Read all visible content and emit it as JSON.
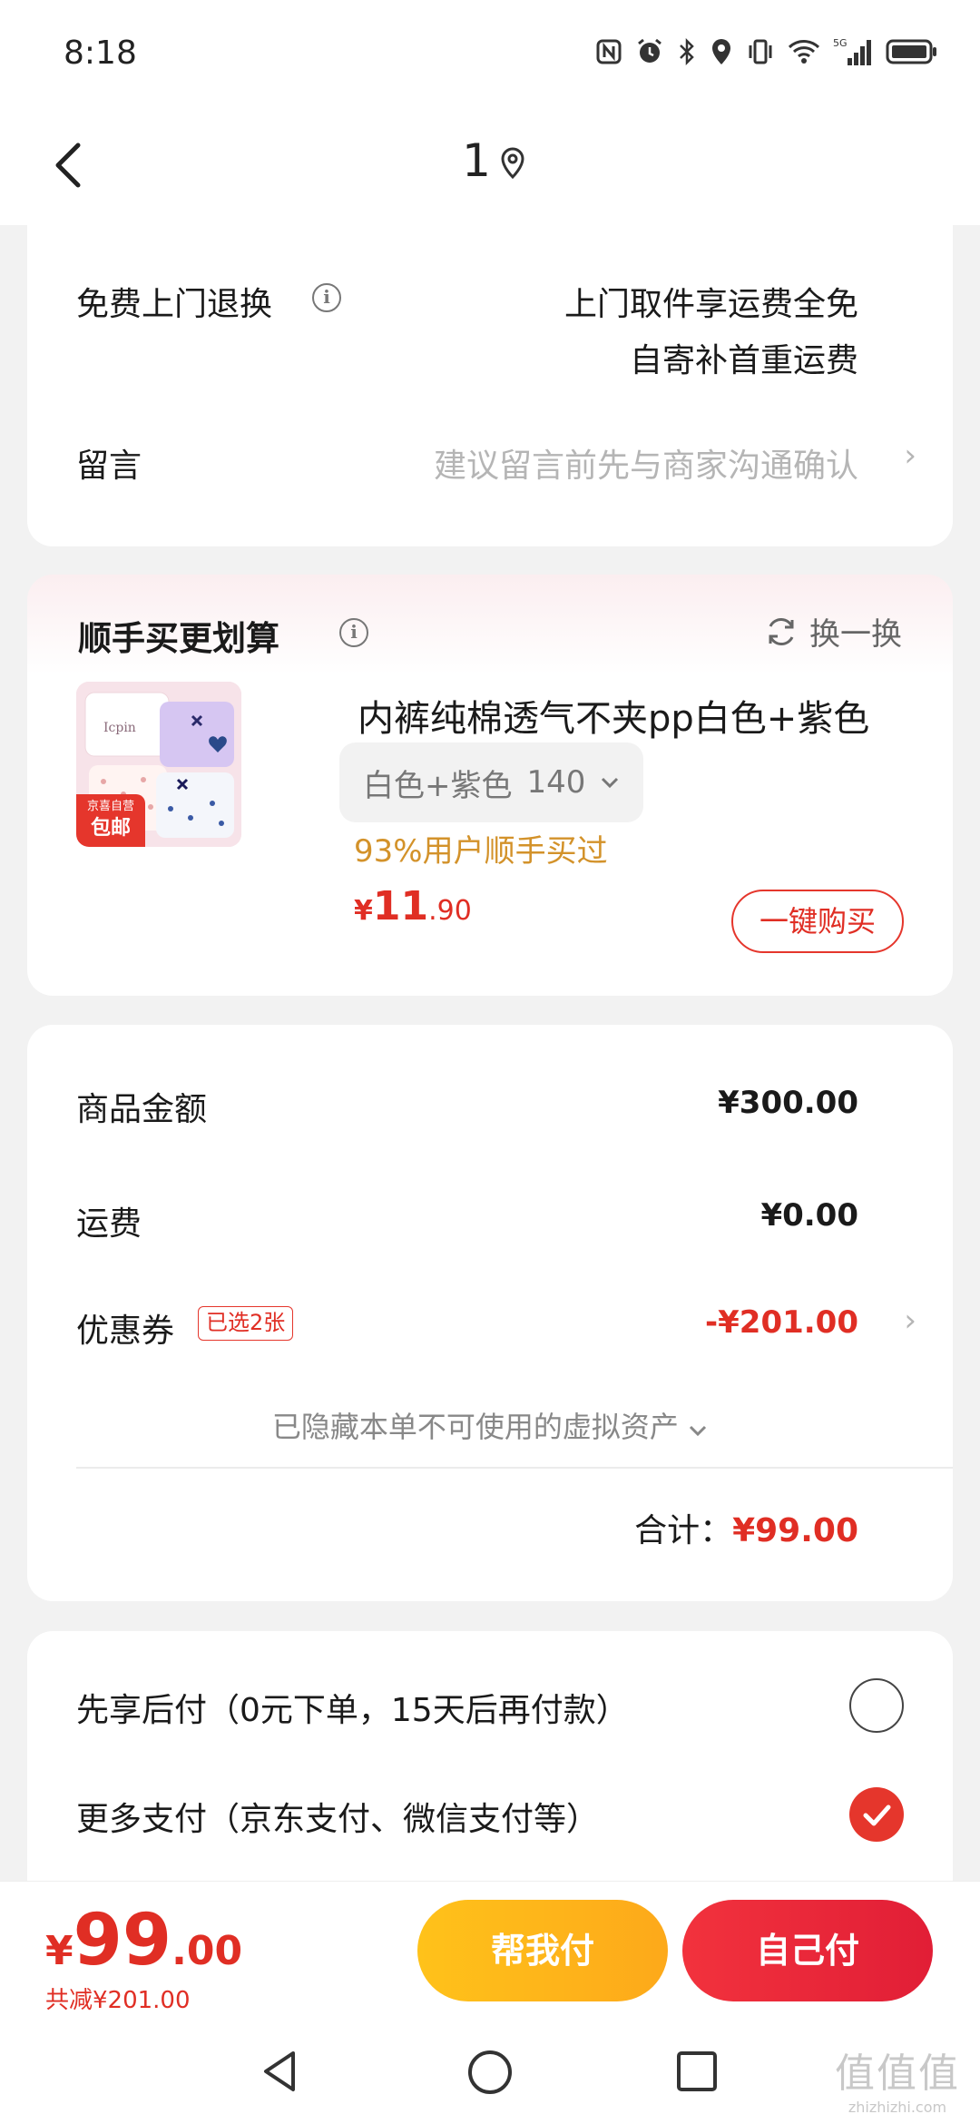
{
  "status_bar": {
    "time": "8:18",
    "network": "5G"
  },
  "nav": {
    "title": "1"
  },
  "return_card": {
    "free_return_label": "免费上门退换",
    "free_return_line1": "上门取件享运费全免",
    "free_return_line2": "自寄补首重运费",
    "message_label": "留言",
    "message_placeholder": "建议留言前先与商家沟通确认"
  },
  "upsell": {
    "title": "顺手买更划算",
    "swap_label": "换一换",
    "product_name": "内裤纯棉透气不夹pp白色+紫色",
    "spec_color": "白色+紫色",
    "spec_size": "140",
    "bought_text": "93%用户顺手买过",
    "price_currency": "¥",
    "price_int": "11",
    "price_dec": ".90",
    "buy_label": "一键购买",
    "badge_top": "京喜自营",
    "badge_bottom": "包邮"
  },
  "summary": {
    "goods_label": "商品金额",
    "goods_value": "¥300.00",
    "shipping_label": "运费",
    "shipping_value": "¥0.00",
    "coupon_label": "优惠券",
    "coupon_tag": "已选2张",
    "coupon_value": "-¥201.00",
    "hidden_assets": "已隐藏本单不可使用的虚拟资产",
    "total_label": "合计：",
    "total_value": "¥99.00"
  },
  "payment": {
    "option1": "先享后付（0元下单，15天后再付款）",
    "option2": "更多支付（京东支付、微信支付等）",
    "selected": 2
  },
  "bottom_bar": {
    "currency": "¥",
    "price_int": "99",
    "price_dec": ".00",
    "saved": "共减¥201.00",
    "help_pay": "帮我付",
    "self_pay": "自己付"
  },
  "watermark": {
    "logo": "值值值",
    "url": "zhizhizhi.com"
  },
  "colors": {
    "accent_red": "#e02e24",
    "help_yellow": "#ffc21a",
    "bought_orange": "#d3922a"
  }
}
